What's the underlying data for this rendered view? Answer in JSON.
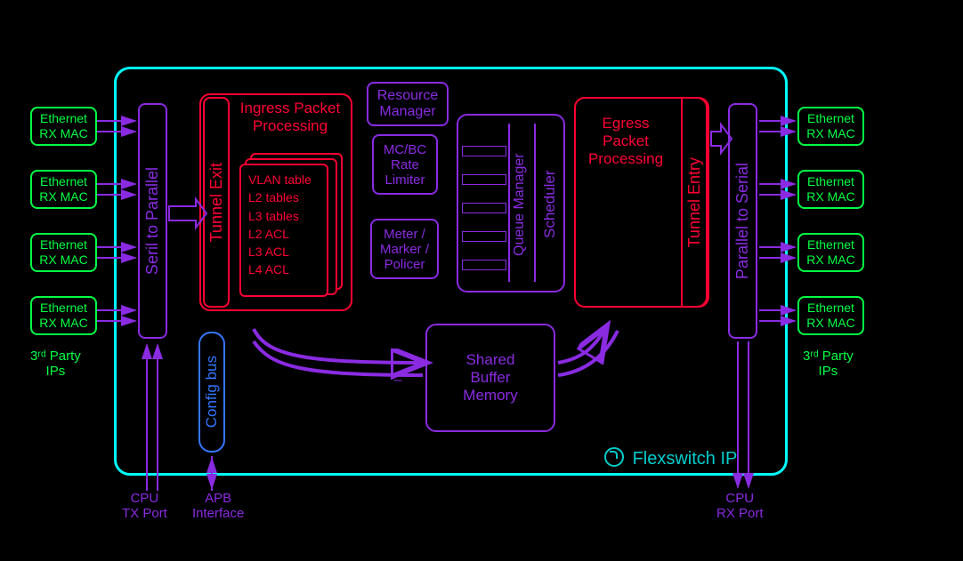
{
  "left_macs": [
    {
      "line1": "Ethernet",
      "line2": "RX MAC"
    },
    {
      "line1": "Ethernet",
      "line2": "RX MAC"
    },
    {
      "line1": "Ethernet",
      "line2": "RX MAC"
    },
    {
      "line1": "Ethernet",
      "line2": "RX MAC"
    }
  ],
  "right_macs": [
    {
      "line1": "Ethernet",
      "line2": "RX MAC"
    },
    {
      "line1": "Ethernet",
      "line2": "RX MAC"
    },
    {
      "line1": "Ethernet",
      "line2": "RX MAC"
    },
    {
      "line1": "Ethernet",
      "line2": "RX MAC"
    }
  ],
  "third_party": "3ʳᵈ Party\nIPs",
  "serial_to_parallel": "Seril to Parallel",
  "parallel_to_serial": "Parallel to Serial",
  "tunnel_exit": "Tunnel Exit",
  "tunnel_entry": "Tunnel Entry",
  "ingress_title": "Ingress Packet\nProcessing",
  "ingress_items": [
    "VLAN table",
    "L2 tables",
    "L3 tables",
    "L2 ACL",
    "L3 ACL",
    "L4 ACL"
  ],
  "resource_manager": "Resource\nManager",
  "mcbc": "MC/BC\nRate\nLimiter",
  "meter": "Meter /\nMarker /\nPolicer",
  "queue_mgr": "Queue\nManager",
  "scheduler": "Scheduler",
  "egress_title": "Egress\nPacket\nProcessing",
  "shared_buffer": "Shared\nBuffer\nMemory",
  "config_bus": "Config bus",
  "cpu_tx": "CPU\nTX Port",
  "cpu_rx": "CPU\nRX Port",
  "apb": "APB\nInterface",
  "brand": "Flexswitch IP",
  "dash": "–"
}
